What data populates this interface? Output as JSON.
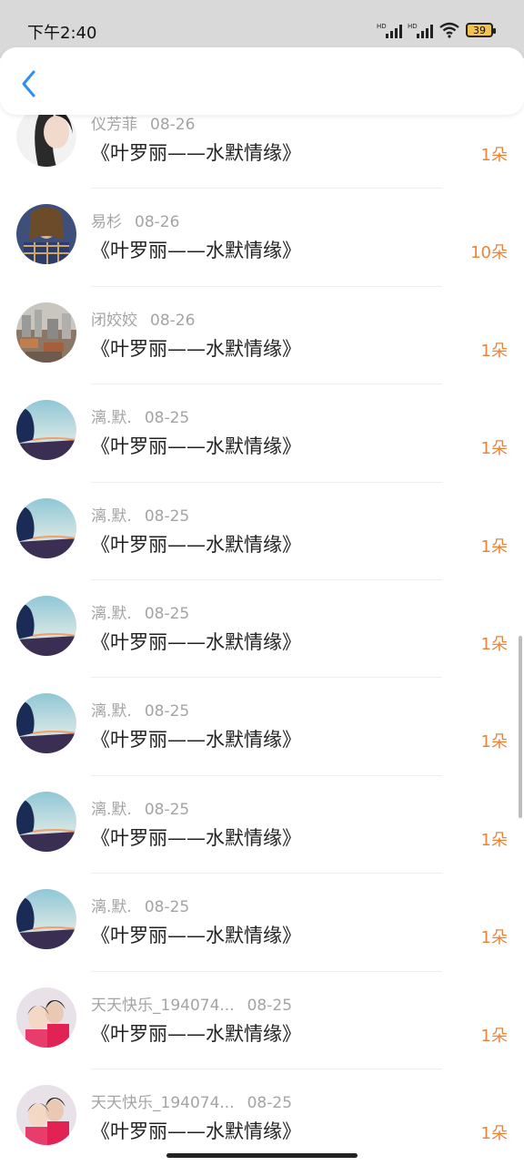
{
  "status_bar": {
    "time": "下午2:40",
    "battery": "39"
  },
  "nav": {
    "back_icon": "chevron-left-icon",
    "accent": "#2e8ff3"
  },
  "items": [
    {
      "name": "仪芳菲",
      "date": "08-26",
      "title": "《叶罗丽——水默情缘》",
      "count": "1朵",
      "avatar": "woman"
    },
    {
      "name": "易杉",
      "date": "08-26",
      "title": "《叶罗丽——水默情缘》",
      "count": "10朵",
      "avatar": "girl-plaid"
    },
    {
      "name": "闭姣姣",
      "date": "08-26",
      "title": "《叶罗丽——水默情缘》",
      "count": "1朵",
      "avatar": "city"
    },
    {
      "name": "漓.默.",
      "date": "08-25",
      "title": "《叶罗丽——水默情缘》",
      "count": "1朵",
      "avatar": "sky"
    },
    {
      "name": "漓.默.",
      "date": "08-25",
      "title": "《叶罗丽——水默情缘》",
      "count": "1朵",
      "avatar": "sky"
    },
    {
      "name": "漓.默.",
      "date": "08-25",
      "title": "《叶罗丽——水默情缘》",
      "count": "1朵",
      "avatar": "sky"
    },
    {
      "name": "漓.默.",
      "date": "08-25",
      "title": "《叶罗丽——水默情缘》",
      "count": "1朵",
      "avatar": "sky"
    },
    {
      "name": "漓.默.",
      "date": "08-25",
      "title": "《叶罗丽——水默情缘》",
      "count": "1朵",
      "avatar": "sky"
    },
    {
      "name": "漓.默.",
      "date": "08-25",
      "title": "《叶罗丽——水默情缘》",
      "count": "1朵",
      "avatar": "sky"
    },
    {
      "name": "天天快乐_194074...",
      "date": "08-25",
      "title": "《叶罗丽——水默情缘》",
      "count": "1朵",
      "avatar": "kids"
    },
    {
      "name": "天天快乐_194074...",
      "date": "08-25",
      "title": "《叶罗丽——水默情缘》",
      "count": "1朵",
      "avatar": "kids"
    }
  ]
}
